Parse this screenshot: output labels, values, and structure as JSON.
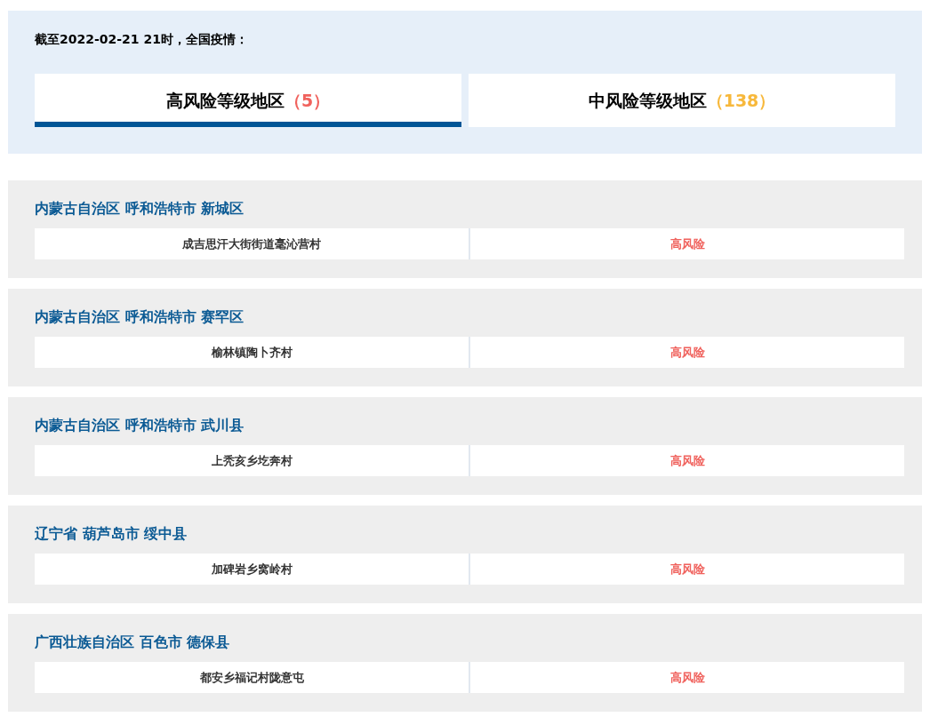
{
  "header": {
    "title": "截至2022-02-21 21时，全国疫情："
  },
  "tabs": [
    {
      "label": "高风险等级地区",
      "count": "（5）",
      "kind": "high",
      "selected": true
    },
    {
      "label": "中风险等级地区",
      "count": "（138）",
      "kind": "medium",
      "selected": false
    }
  ],
  "areas": [
    {
      "region": "内蒙古自治区 呼和浩特市 新城区",
      "rows": [
        {
          "place": "成吉思汗大街街道毫沁营村",
          "risk": "高风险",
          "kind": "high"
        }
      ]
    },
    {
      "region": "内蒙古自治区 呼和浩特市 赛罕区",
      "rows": [
        {
          "place": "榆林镇陶卜齐村",
          "risk": "高风险",
          "kind": "high"
        }
      ]
    },
    {
      "region": "内蒙古自治区 呼和浩特市 武川县",
      "rows": [
        {
          "place": "上秃亥乡圪奔村",
          "risk": "高风险",
          "kind": "high"
        }
      ]
    },
    {
      "region": "辽宁省 葫芦岛市 绥中县",
      "rows": [
        {
          "place": "加碑岩乡窝岭村",
          "risk": "高风险",
          "kind": "high"
        }
      ]
    },
    {
      "region": "广西壮族自治区 百色市 德保县",
      "rows": [
        {
          "place": "都安乡福记村陇意屯",
          "risk": "高风险",
          "kind": "high"
        }
      ]
    }
  ]
}
